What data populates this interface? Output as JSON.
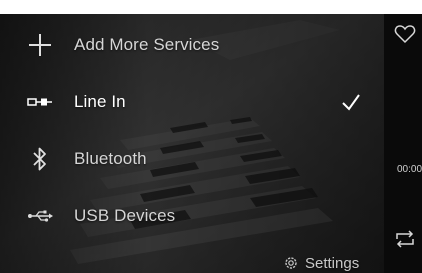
{
  "menu": {
    "items": [
      {
        "label": "Add More Services",
        "icon": "plus-icon",
        "state": "normal"
      },
      {
        "label": "Line In",
        "icon": "line-in-icon",
        "state": "selected"
      },
      {
        "label": "Bluetooth",
        "icon": "bluetooth-icon",
        "state": "normal"
      },
      {
        "label": "USB Devices",
        "icon": "usb-icon",
        "state": "normal"
      }
    ]
  },
  "settings": {
    "label": "Settings",
    "icon": "gear-icon"
  },
  "side": {
    "time": "00:00",
    "icons": [
      "heart-icon",
      "repeat-icon"
    ]
  },
  "colors": {
    "active_text": "#ffffff",
    "dim_text": "#d6d6d6",
    "side_bg": "#0a0a0a"
  }
}
